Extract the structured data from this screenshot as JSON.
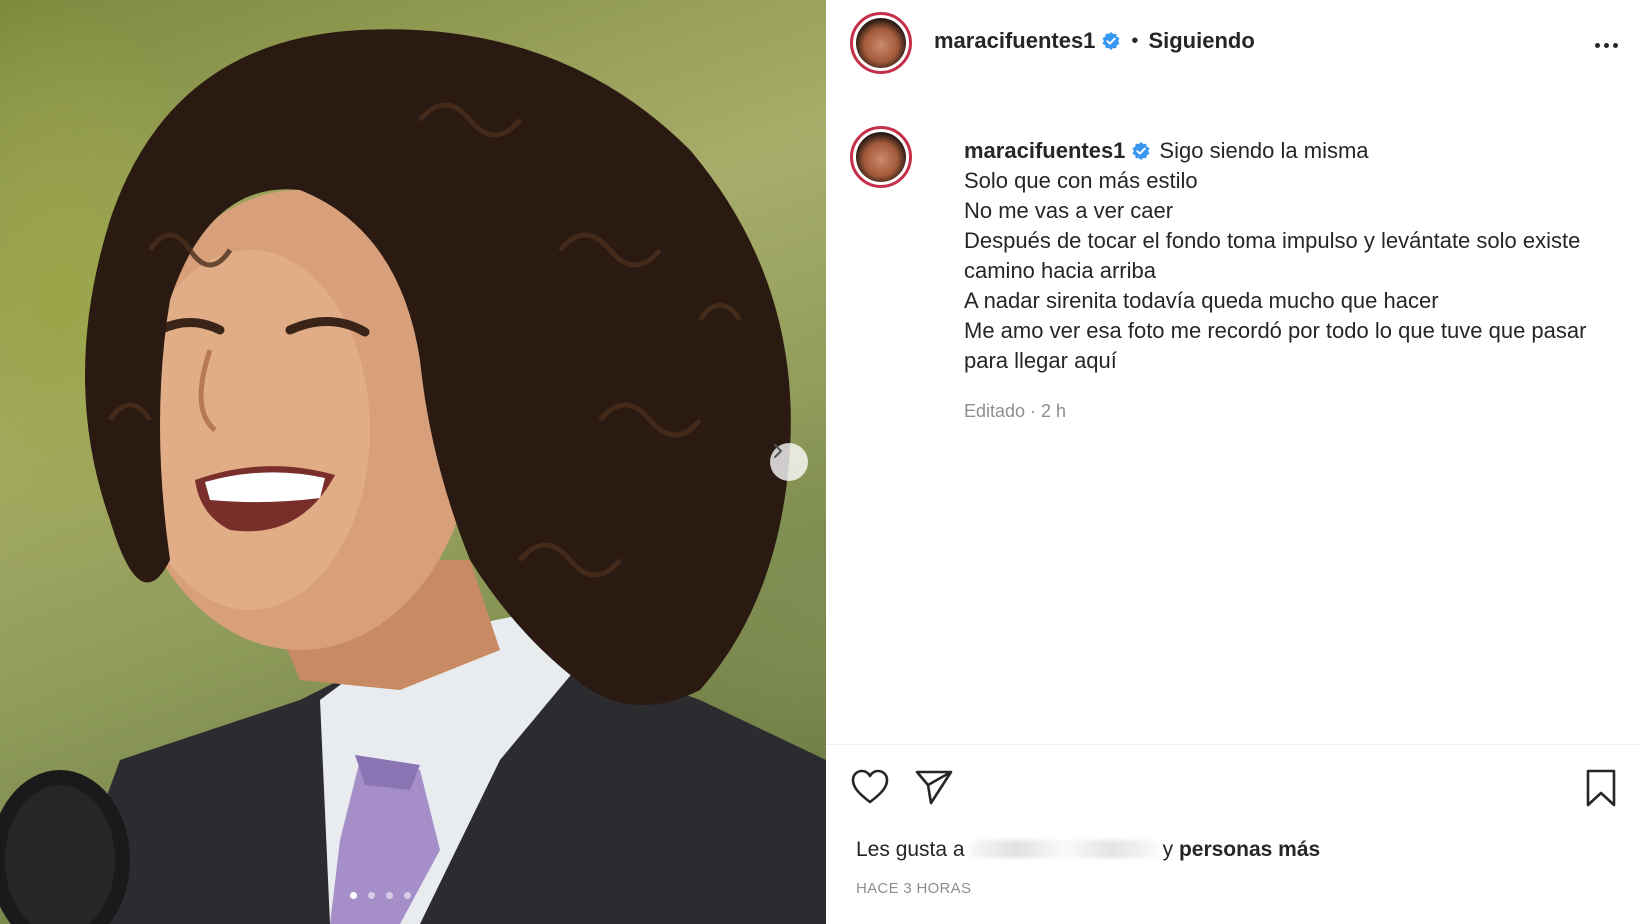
{
  "header": {
    "username": "maracifuentes1",
    "separator": "•",
    "follow_status": "Siguiendo"
  },
  "caption": {
    "username": "maracifuentes1",
    "lines": [
      "Sigo siendo la misma",
      "Solo que con más estilo",
      "No me vas a ver caer",
      "Después de tocar el fondo toma impulso y levántate solo existe",
      "camino hacia arriba",
      "A nadar sirenita todavía queda mucho que hacer",
      "Me amo ver esa foto me recordó por todo lo que tuve que pasar",
      "para llegar aquí"
    ],
    "edited": "Editado · 2 h"
  },
  "likes": {
    "prefix": "Les gusta a",
    "suffix_plain": "y",
    "suffix_bold": "personas más"
  },
  "time_ago": "HACE 3 HORAS",
  "carousel": {
    "total": 4,
    "active": 1
  },
  "icons": {
    "verified": "verified-badge-icon",
    "more": "more-options-icon",
    "like": "heart-icon",
    "share": "send-icon",
    "save": "bookmark-icon",
    "next": "chevron-right-icon"
  },
  "colors": {
    "verified": "#3897f0",
    "avatar_ring": "#c4304a",
    "secondary_text": "#8e8e8e",
    "primary_text": "#262626"
  }
}
